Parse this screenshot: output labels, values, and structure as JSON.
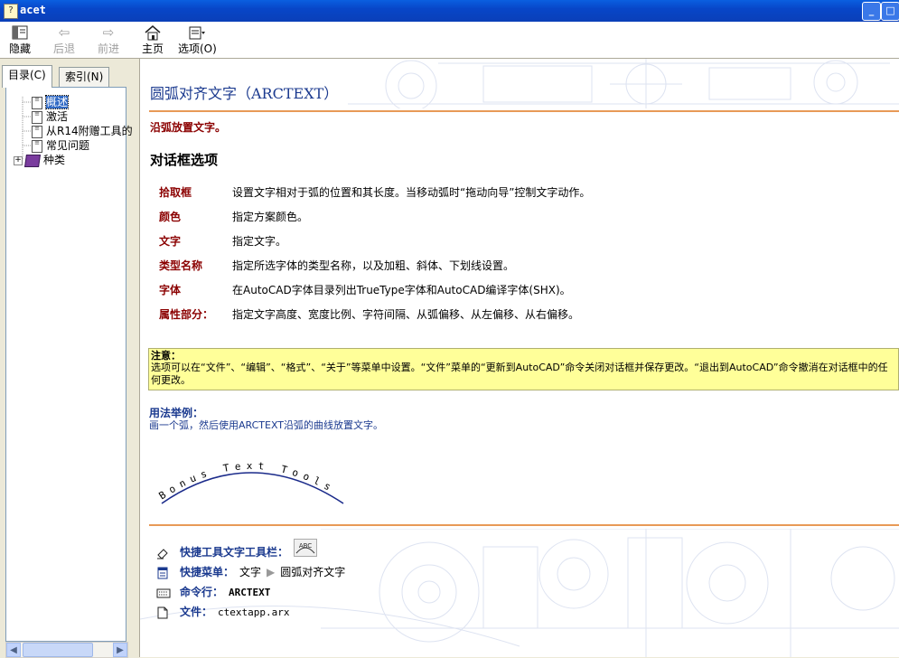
{
  "window": {
    "title": "acet"
  },
  "toolbar": {
    "hide": "隐藏",
    "back": "后退",
    "forward": "前进",
    "home": "主页",
    "options": "选项(O)"
  },
  "tabs": {
    "contents": "目录(C)",
    "index": "索引(N)"
  },
  "tree": {
    "overview": "概述",
    "activate": "激活",
    "from_r14": "从R14附赠工具的",
    "faq": "常见问题",
    "types": "种类"
  },
  "page": {
    "title": "圆弧对齐文字（ARCTEXT）",
    "lead": "沿弧放置文字。",
    "section": "对话框选项",
    "options": [
      {
        "term": "拾取框",
        "desc": "设置文字相对于弧的位置和其长度。当移动弧时“拖动向导”控制文字动作。"
      },
      {
        "term": "颜色",
        "desc": "指定方案颜色。"
      },
      {
        "term": "文字",
        "desc": "指定文字。"
      },
      {
        "term": "类型名称",
        "desc": "指定所选字体的类型名称，以及加粗、斜体、下划线设置。"
      },
      {
        "term": "字体",
        "desc": "在AutoCAD字体目录列出TrueType字体和AutoCAD编译字体(SHX)。"
      },
      {
        "term": "属性部分：",
        "desc": "指定文字高度、宽度比例、字符间隔、从弧偏移、从左偏移、从右偏移。"
      }
    ],
    "note_title": "注意：",
    "note_body": "选项可以在“文件”、“编辑”、“格式”、“关于”等菜单中设置。“文件”菜单的“更新到AutoCAD”命令关闭对话框并保存更改。“退出到AutoCAD”命令撤消在对话框中的任何更改。",
    "example_title": "用法举例：",
    "example_desc": "画一个弧，然后使用ARCTEXT沿弧的曲线放置文字。",
    "example_arc_text": "Bonus Text Tools",
    "toolbar_icon_text": "ABC",
    "footer": {
      "toolbar_label": "快捷工具文字工具栏：",
      "menu_label": "快捷菜单：",
      "menu_path_1": "文字",
      "menu_path_2": "圆弧对齐文字",
      "command_label": "命令行：",
      "command_value": "ARCTEXT",
      "file_label": "文件：",
      "file_value": "ctextapp.arx"
    }
  },
  "colors": {
    "title_blue": "#1b3a8f",
    "term_red": "#8b0000",
    "rule_orange": "#e89a57",
    "note_yellow": "#ffff99"
  }
}
